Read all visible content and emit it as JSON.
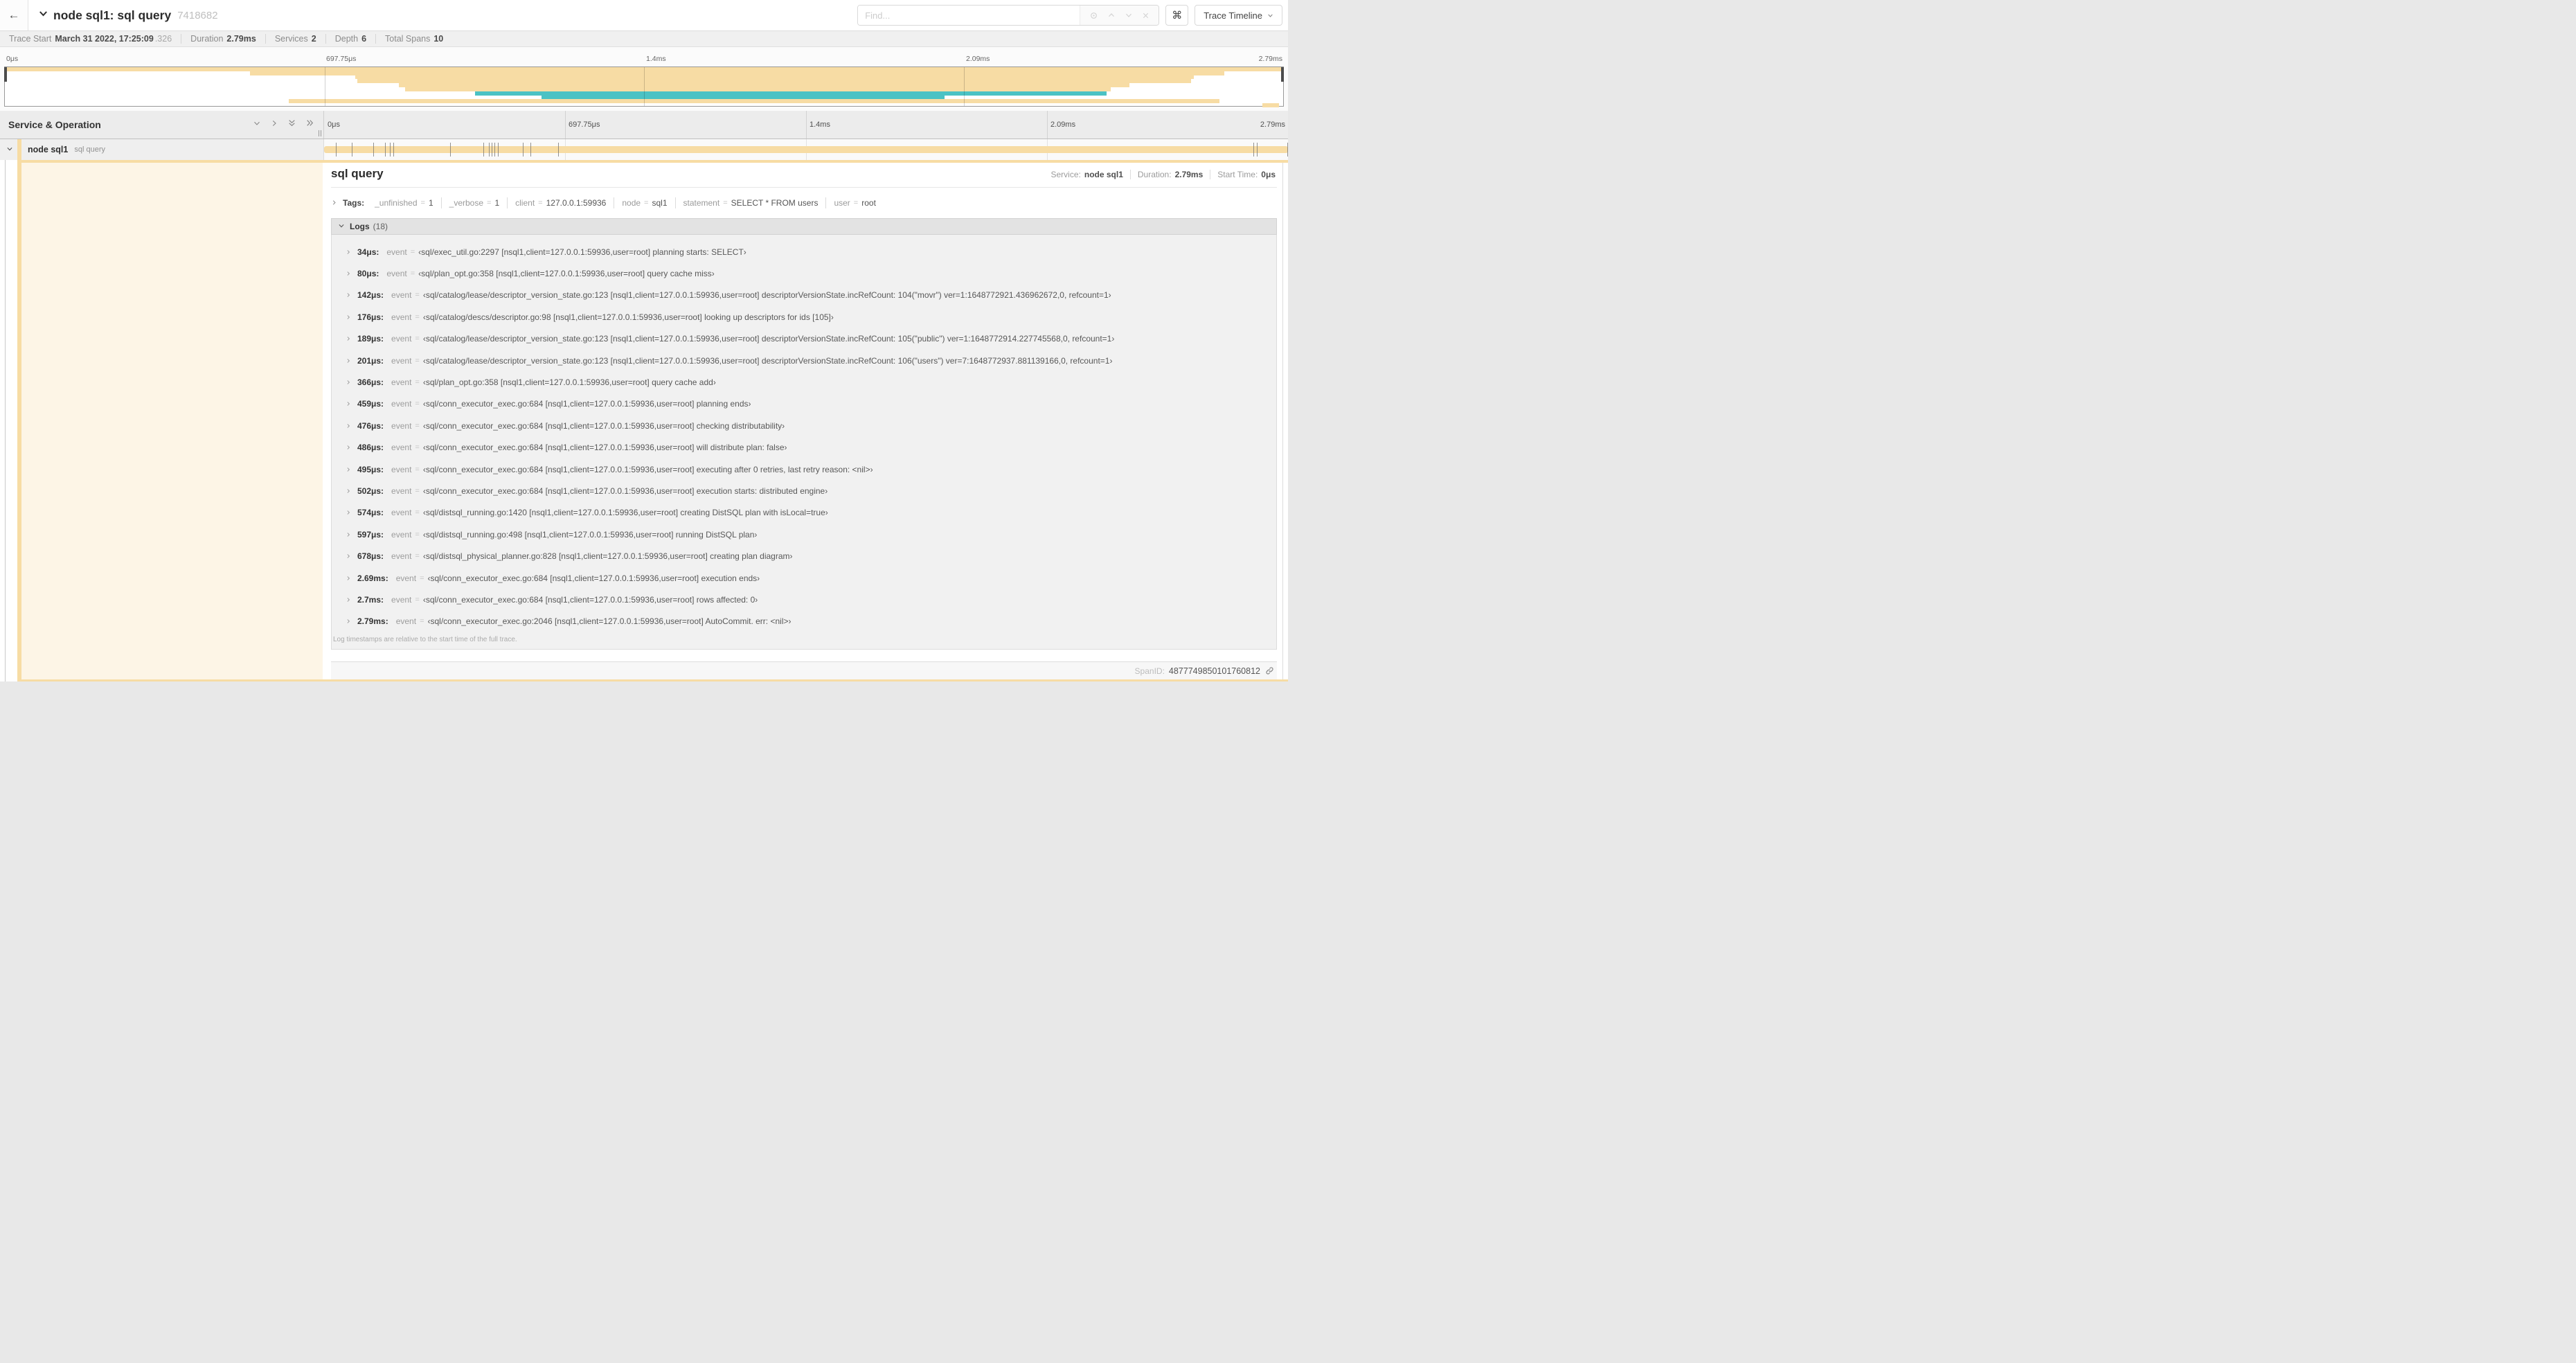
{
  "colors": {
    "tan": "#f7dca4",
    "teal": "#4bc2c4",
    "cream": "rgba(247,220,164,0.28)"
  },
  "header": {
    "back_icon": "←",
    "title": "node sql1: sql query",
    "trace_id": "7418682",
    "find_placeholder": "Find...",
    "shortcut_icon": "⌘",
    "view_selector_label": "Trace Timeline"
  },
  "summary": {
    "trace_start_label": "Trace Start",
    "trace_start_value": "March 31 2022, 17:25:09",
    "trace_start_fraction": ".326",
    "duration_label": "Duration",
    "duration_value": "2.79ms",
    "services_label": "Services",
    "services_value": "2",
    "depth_label": "Depth",
    "depth_value": "6",
    "total_spans_label": "Total Spans",
    "total_spans_value": "10"
  },
  "ruler": {
    "labels": [
      {
        "text": "0μs",
        "pct": 0
      },
      {
        "text": "697.75μs",
        "pct": 25
      },
      {
        "text": "1.4ms",
        "pct": 50
      },
      {
        "text": "2.09ms",
        "pct": 75
      },
      {
        "text": "2.79ms",
        "pct": 100
      }
    ],
    "gridlines_pct": [
      25,
      50,
      75
    ]
  },
  "minimap": {
    "spans": [
      {
        "start": 0,
        "end": 100,
        "color": "tan"
      },
      {
        "start": 19.2,
        "end": 95.4,
        "color": "tan"
      },
      {
        "start": 27.4,
        "end": 93,
        "color": "tan"
      },
      {
        "start": 27.6,
        "end": 92.8,
        "color": "tan"
      },
      {
        "start": 30.8,
        "end": 88,
        "color": "tan"
      },
      {
        "start": 31.3,
        "end": 86.5,
        "color": "tan"
      },
      {
        "start": 36.8,
        "end": 86.2,
        "color": "teal"
      },
      {
        "start": 42,
        "end": 73.5,
        "color": "teal"
      },
      {
        "start": 22.2,
        "end": 95,
        "color": "tan"
      },
      {
        "start": 98.4,
        "end": 99.7,
        "color": "tan"
      }
    ]
  },
  "timeline": {
    "left_header": "Service & Operation"
  },
  "span_row": {
    "service": "node sql1",
    "operation": "sql query",
    "bar": {
      "start": 0,
      "end": 100,
      "color": "tan"
    },
    "ticks_pct": [
      1.2,
      2.9,
      5.1,
      6.3,
      6.8,
      7.2,
      13.1,
      16.5,
      17.1,
      17.4,
      17.7,
      18.0,
      20.6,
      21.4,
      24.3,
      96.4,
      96.8,
      99.9
    ]
  },
  "detail": {
    "operation": "sql query",
    "service_label": "Service:",
    "service": "node sql1",
    "duration_label": "Duration:",
    "duration": "2.79ms",
    "start_label": "Start Time:",
    "start": "0μs",
    "tags_label": "Tags:",
    "eq": "=",
    "tags": [
      {
        "key": "_unfinished",
        "value": "1"
      },
      {
        "key": "_verbose",
        "value": "1"
      },
      {
        "key": "client",
        "value": "127.0.0.1:59936"
      },
      {
        "key": "node",
        "value": "sql1"
      },
      {
        "key": "statement",
        "value": "SELECT * FROM users"
      },
      {
        "key": "user",
        "value": "root"
      }
    ],
    "logs_label": "Logs",
    "logs_count": "(18)",
    "log_field": "event",
    "logs": [
      {
        "t": "34μs:",
        "value": "‹sql/exec_util.go:2297 [nsql1,client=127.0.0.1:59936,user=root] planning starts: SELECT›"
      },
      {
        "t": "80μs:",
        "value": "‹sql/plan_opt.go:358 [nsql1,client=127.0.0.1:59936,user=root] query cache miss›"
      },
      {
        "t": "142μs:",
        "value": "‹sql/catalog/lease/descriptor_version_state.go:123 [nsql1,client=127.0.0.1:59936,user=root] descriptorVersionState.incRefCount: 104(\"movr\") ver=1:1648772921.436962672,0, refcount=1›"
      },
      {
        "t": "176μs:",
        "value": "‹sql/catalog/descs/descriptor.go:98 [nsql1,client=127.0.0.1:59936,user=root] looking up descriptors for ids [105]›"
      },
      {
        "t": "189μs:",
        "value": "‹sql/catalog/lease/descriptor_version_state.go:123 [nsql1,client=127.0.0.1:59936,user=root] descriptorVersionState.incRefCount: 105(\"public\") ver=1:1648772914.227745568,0, refcount=1›"
      },
      {
        "t": "201μs:",
        "value": "‹sql/catalog/lease/descriptor_version_state.go:123 [nsql1,client=127.0.0.1:59936,user=root] descriptorVersionState.incRefCount: 106(\"users\") ver=7:1648772937.881139166,0, refcount=1›"
      },
      {
        "t": "366μs:",
        "value": "‹sql/plan_opt.go:358 [nsql1,client=127.0.0.1:59936,user=root] query cache add›"
      },
      {
        "t": "459μs:",
        "value": "‹sql/conn_executor_exec.go:684 [nsql1,client=127.0.0.1:59936,user=root] planning ends›"
      },
      {
        "t": "476μs:",
        "value": "‹sql/conn_executor_exec.go:684 [nsql1,client=127.0.0.1:59936,user=root] checking distributability›"
      },
      {
        "t": "486μs:",
        "value": "‹sql/conn_executor_exec.go:684 [nsql1,client=127.0.0.1:59936,user=root] will distribute plan: false›"
      },
      {
        "t": "495μs:",
        "value": "‹sql/conn_executor_exec.go:684 [nsql1,client=127.0.0.1:59936,user=root] executing after 0 retries, last retry reason: <nil>›"
      },
      {
        "t": "502μs:",
        "value": "‹sql/conn_executor_exec.go:684 [nsql1,client=127.0.0.1:59936,user=root] execution starts: distributed engine›"
      },
      {
        "t": "574μs:",
        "value": "‹sql/distsql_running.go:1420 [nsql1,client=127.0.0.1:59936,user=root] creating DistSQL plan with isLocal=true›"
      },
      {
        "t": "597μs:",
        "value": "‹sql/distsql_running.go:498 [nsql1,client=127.0.0.1:59936,user=root] running DistSQL plan›"
      },
      {
        "t": "678μs:",
        "value": "‹sql/distsql_physical_planner.go:828 [nsql1,client=127.0.0.1:59936,user=root] creating plan diagram›"
      },
      {
        "t": "2.69ms:",
        "value": "‹sql/conn_executor_exec.go:684 [nsql1,client=127.0.0.1:59936,user=root] execution ends›"
      },
      {
        "t": "2.7ms:",
        "value": "‹sql/conn_executor_exec.go:684 [nsql1,client=127.0.0.1:59936,user=root] rows affected: 0›"
      },
      {
        "t": "2.79ms:",
        "value": "‹sql/conn_executor_exec.go:2046 [nsql1,client=127.0.0.1:59936,user=root] AutoCommit. err: <nil>›"
      }
    ],
    "logs_note": "Log timestamps are relative to the start time of the full trace.",
    "spanid_label": "SpanID:",
    "spanid": "4877749850101760812"
  }
}
